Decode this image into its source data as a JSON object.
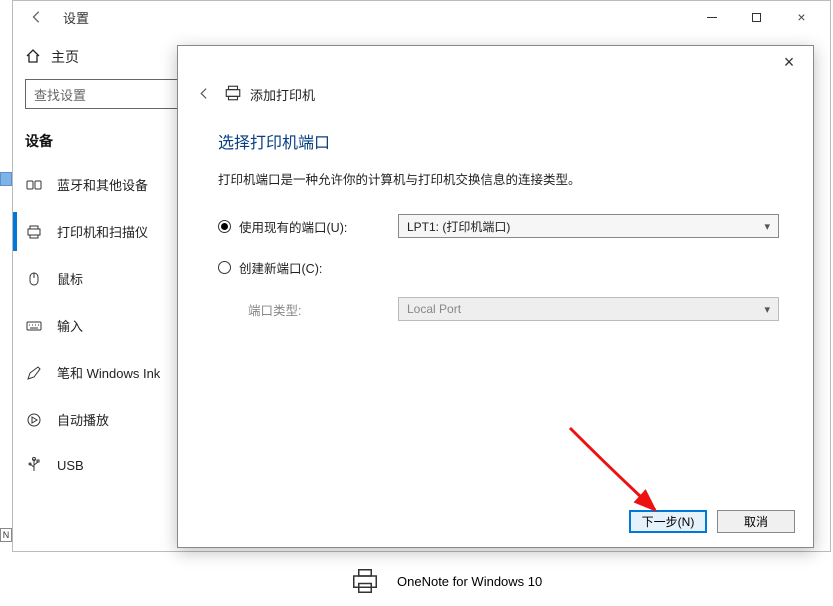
{
  "window": {
    "title": "设置",
    "controls": {
      "min": "—",
      "max": "□",
      "close": "×"
    }
  },
  "sidebar": {
    "home_label": "主页",
    "search_placeholder": "查找设置",
    "section": "设备",
    "items": [
      {
        "icon": "bluetooth-icon",
        "label": "蓝牙和其他设备"
      },
      {
        "icon": "printer-icon",
        "label": "打印机和扫描仪"
      },
      {
        "icon": "mouse-icon",
        "label": "鼠标"
      },
      {
        "icon": "keyboard-icon",
        "label": "输入"
      },
      {
        "icon": "pen-icon",
        "label": "笔和 Windows Ink"
      },
      {
        "icon": "autoplay-icon",
        "label": "自动播放"
      },
      {
        "icon": "usb-icon",
        "label": "USB"
      }
    ],
    "active_index": 1
  },
  "printer_row": {
    "name": "OneNote for Windows 10"
  },
  "dialog": {
    "title": "添加打印机",
    "heading": "选择打印机端口",
    "description": "打印机端口是一种允许你的计算机与打印机交换信息的连接类型。",
    "radios": {
      "use_existing": "使用现有的端口(U):",
      "create_new": "创建新端口(C):"
    },
    "port_type_label": "端口类型:",
    "existing_port_value": "LPT1: (打印机端口)",
    "new_port_type_value": "Local Port",
    "selected_radio": "use_existing",
    "buttons": {
      "next": "下一步(N)",
      "cancel": "取消"
    }
  },
  "left_selector_text": "N"
}
